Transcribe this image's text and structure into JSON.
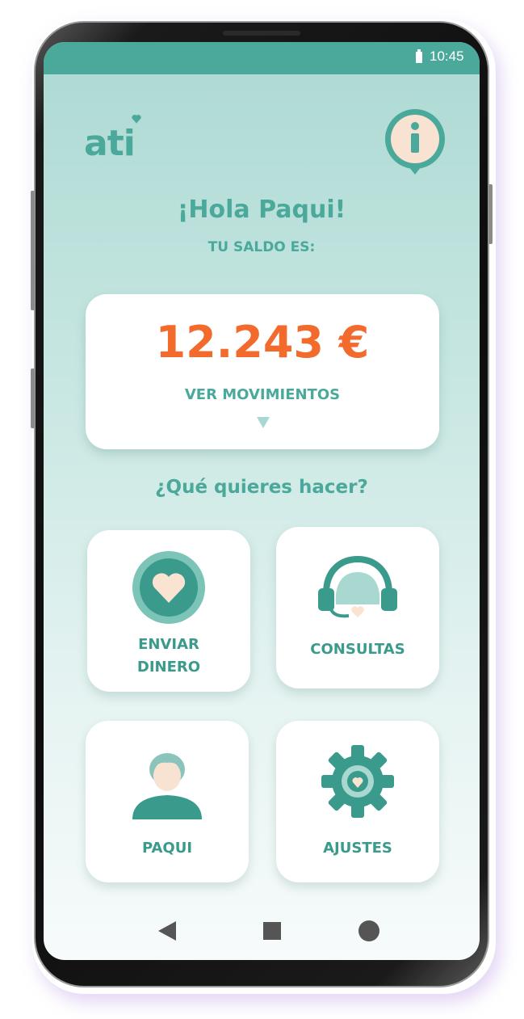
{
  "status_bar": {
    "time": "10:45"
  },
  "app": {
    "logo_text": "ati"
  },
  "header": {
    "greeting": "¡Hola Paqui!",
    "balance_label": "TU SALDO ES:"
  },
  "balance_card": {
    "amount": "12.243 €",
    "movements_link": "VER MOVIMIENTOS"
  },
  "actions": {
    "question": "¿Qué quieres hacer?",
    "tiles": [
      {
        "label": "ENVIAR\nDINERO",
        "icon": "heart-coin-icon"
      },
      {
        "label": "CONSULTAS",
        "icon": "headset-icon"
      },
      {
        "label": "PAQUI",
        "icon": "user-avatar-icon"
      },
      {
        "label": "AJUSTES",
        "icon": "gear-icon"
      }
    ]
  },
  "colors": {
    "brand": "#4aa99a",
    "amount": "#f26a2c",
    "heart": "#fbe3d2"
  }
}
